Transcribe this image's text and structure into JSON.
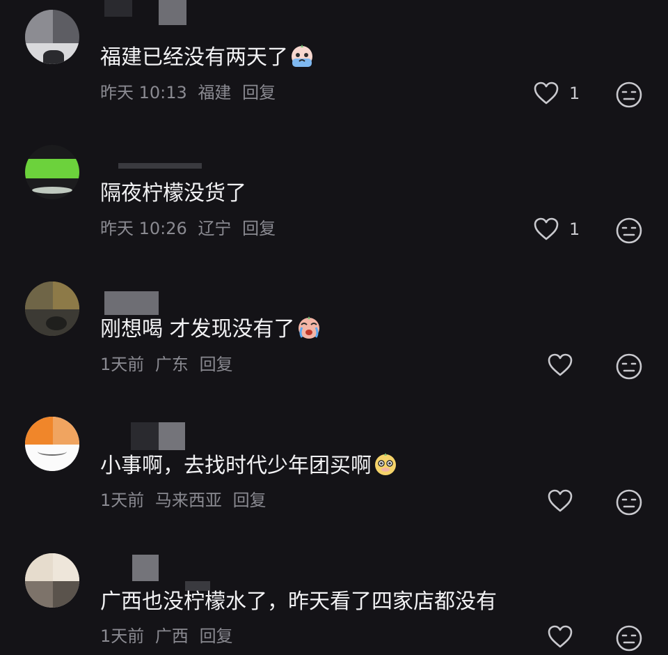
{
  "comments": [
    {
      "text": "福建已经没有两天了",
      "emoji": "crying-face-emoji",
      "time": "昨天 10:13",
      "location": "福建",
      "reply": "回复",
      "likes": "1"
    },
    {
      "text": "隔夜柠檬没货了",
      "time": "昨天 10:26",
      "location": "辽宁",
      "reply": "回复",
      "likes": "1"
    },
    {
      "text": "刚想喝 才发现没有了",
      "emoji": "tearful-face-emoji",
      "time": "1天前",
      "location": "广东",
      "reply": "回复",
      "likes": ""
    },
    {
      "text": "小事啊，去找时代少年团买啊",
      "emoji": "smug-face-emoji",
      "time": "1天前",
      "location": "马来西亚",
      "reply": "回复",
      "likes": ""
    },
    {
      "text": "广西也没柠檬水了，昨天看了四家店都没有",
      "time": "1天前",
      "location": "广西",
      "reply": "回复",
      "likes": ""
    }
  ],
  "icons": {
    "like": "heart-outline-icon",
    "dislike": "neutral-face-icon"
  },
  "colors": {
    "background": "#141317",
    "text": "#f2f2f4",
    "meta": "#8a8a91",
    "icon": "#c9c9ce"
  }
}
